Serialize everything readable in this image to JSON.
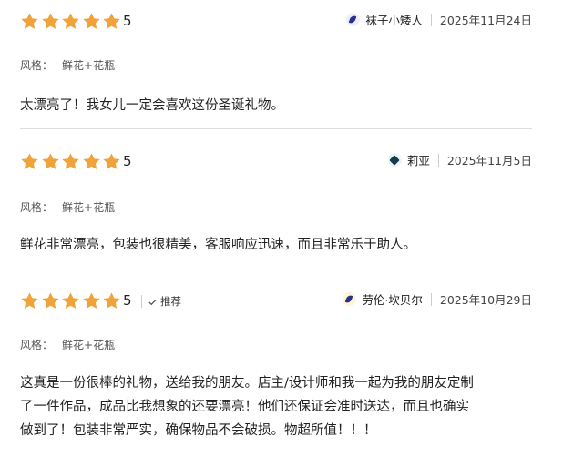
{
  "reviews": [
    {
      "rating": "5",
      "author": "袜子小矮人",
      "date": "2025年11月24日",
      "meta_label": "风格：",
      "meta_value": "鲜花+花瓶",
      "body": "太漂亮了！我女儿一定会喜欢这份圣诞礼物。",
      "avatar_icon": "crescent-avatar-icon",
      "avatar_color": "#2b2f8f"
    },
    {
      "rating": "5",
      "author": "莉亚",
      "date": "2025年11月5日",
      "meta_label": "风格：",
      "meta_value": "鲜花+花瓶",
      "body": "鲜花非常漂亮，包装也很精美，客服响应迅速，而且非常乐于助人。",
      "avatar_icon": "diamond-avatar-icon",
      "avatar_color": "#143a52"
    },
    {
      "rating": "5",
      "recommend": "推荐",
      "author": "劳伦·坎贝尔",
      "date": "2025年10月29日",
      "meta_label": "风格：",
      "meta_value": "鲜花+花瓶",
      "body_lines": [
        "这真是一份很棒的礼物，送给我的朋友。店主/设计师和我一起为我的朋友定制",
        "了一件作品，成品比我想象的还要漂亮！他们还保证会准时送达，而且也确实",
        "做到了！包装非常严实，确保物品不会破损。物超所值！！！"
      ],
      "avatar_icon": "crescent-avatar-icon",
      "avatar_color": "#2b2f8f"
    }
  ],
  "colors": {
    "star": "#f1a33b",
    "divider": "#dddddd",
    "recommend_check": "#555555"
  }
}
